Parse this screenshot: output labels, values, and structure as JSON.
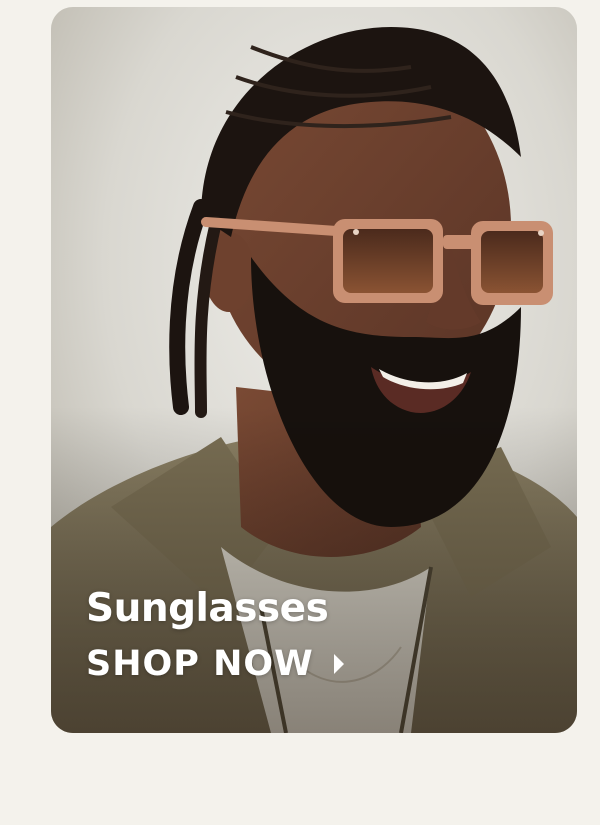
{
  "card": {
    "title": "Sunglasses",
    "cta_label": "SHOP NOW",
    "cta_icon": "chevron-right-icon",
    "image_subject": "smiling bearded man with braided hair wearing amber tinted square sunglasses and an olive jacket"
  },
  "colors": {
    "page_background": "#f4f2ec",
    "text": "#ffffff",
    "jacket": "#7d7258",
    "lens": "#6b3d22",
    "frame": "#c98f72"
  }
}
